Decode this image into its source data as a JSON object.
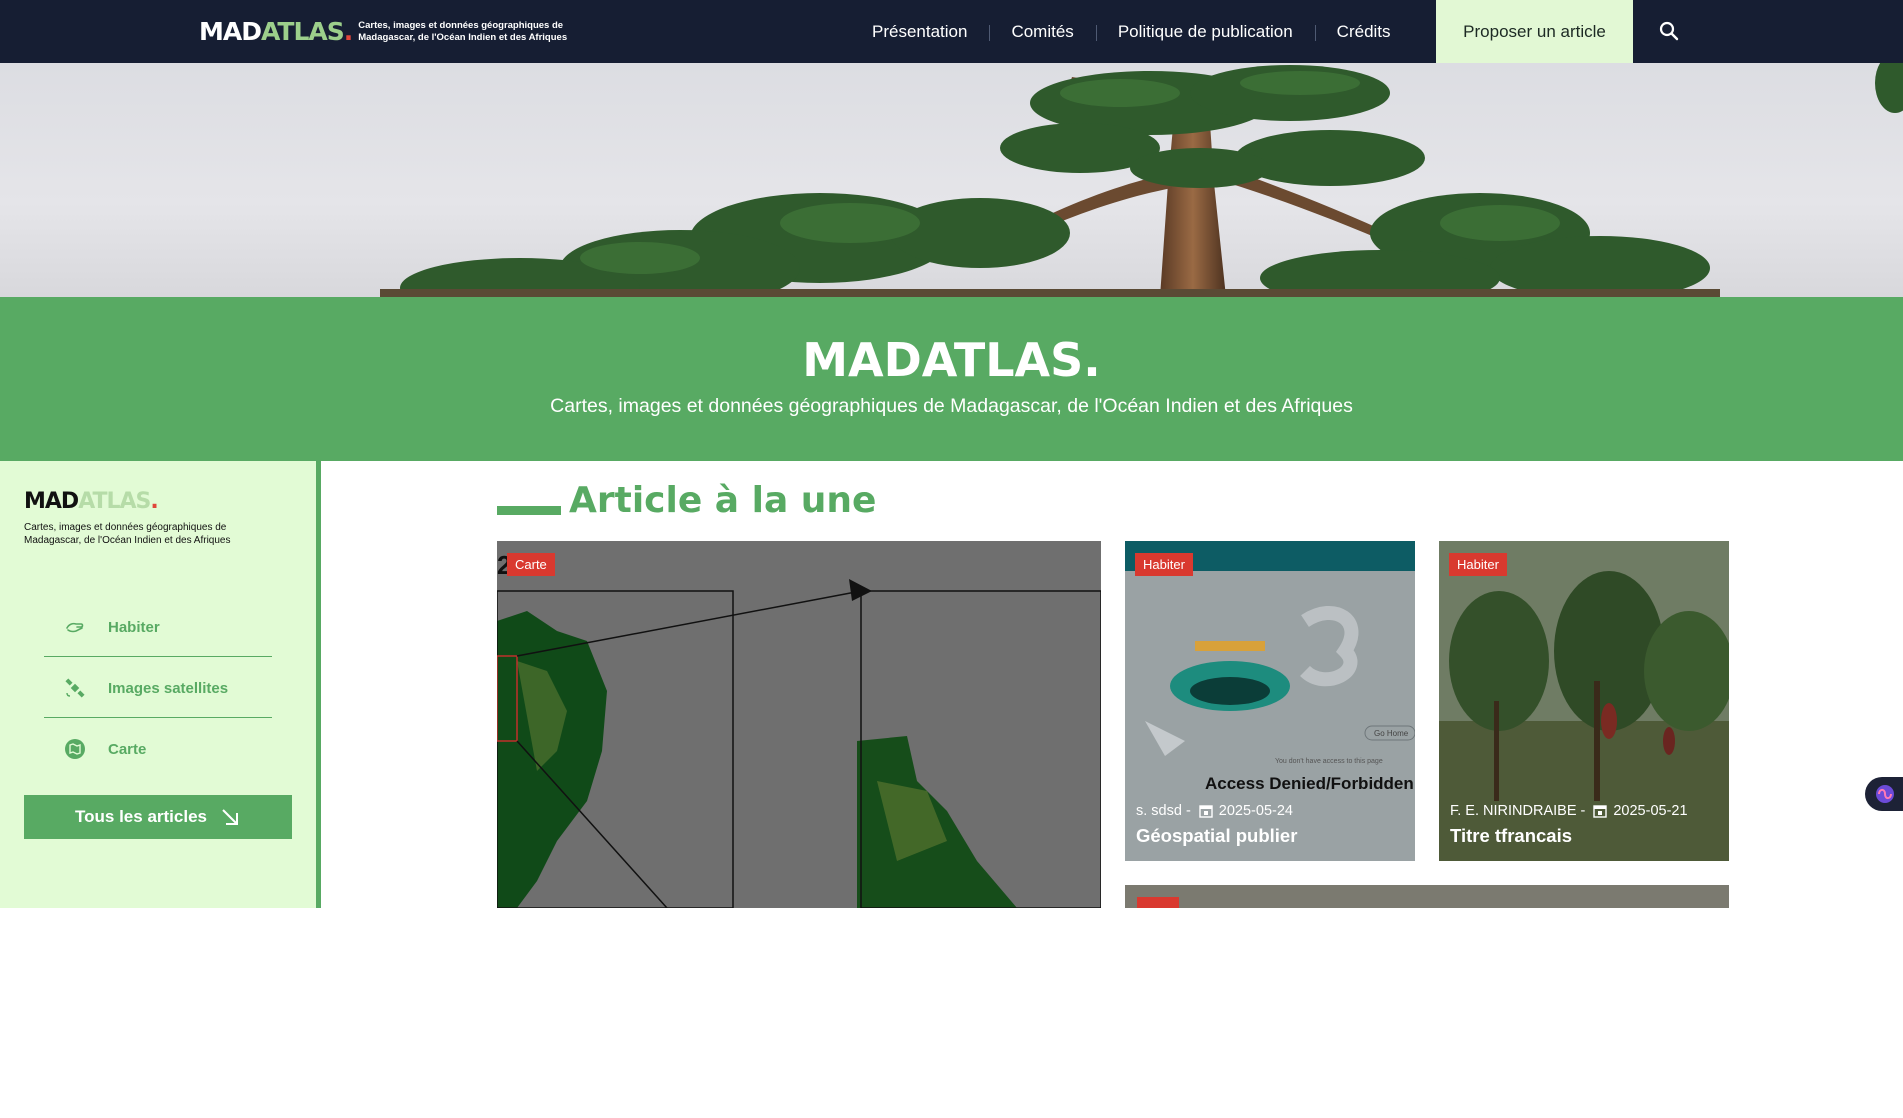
{
  "header": {
    "logo_mad": "MAD",
    "logo_atlas": "ATLAS",
    "logo_dot": ".",
    "logo_tagline": "Cartes, images et données géographiques de Madagascar, de l'Océan Indien et des Afriques",
    "nav": [
      "Présentation",
      "Comités",
      "Politique de publication",
      "Crédits"
    ],
    "cta": "Proposer un article",
    "search_icon": "search-icon"
  },
  "banner": {
    "title": "MADATLAS.",
    "subtitle": "Cartes, images et données géographiques de Madagascar, de l'Océan Indien et des Afriques"
  },
  "sidebar": {
    "logo_mad": "MAD",
    "logo_atlas": "ATLAS",
    "logo_dot": ".",
    "tagline": "Cartes, images et données géographiques de Madagascar, de l'Océan Indien et des Afriques",
    "items": [
      {
        "label": "Habiter",
        "icon": "hand-icon"
      },
      {
        "label": "Images satellites",
        "icon": "satellite-icon"
      },
      {
        "label": "Carte",
        "icon": "map-icon"
      }
    ],
    "all_button": "Tous les articles"
  },
  "featured": {
    "section_title": "Article à la une",
    "main_card": {
      "badge": "Carte"
    },
    "cards": [
      {
        "badge": "Habiter",
        "author": "s. sdsd",
        "date": "2025-05-24",
        "title": "Géospatial publier",
        "image_text": "Access Denied/Forbidden",
        "image_subtext": "You don't have access to this page",
        "image_button": "Go Home"
      },
      {
        "badge": "Habiter",
        "author": "F. E. NIRINDRAIBE",
        "date": "2025-05-21",
        "title": "Titre tfrancais"
      }
    ]
  },
  "colors": {
    "navy": "#161e33",
    "green": "#58aa63",
    "light_green": "#e2fbd5",
    "badge_red": "#d9392f"
  }
}
